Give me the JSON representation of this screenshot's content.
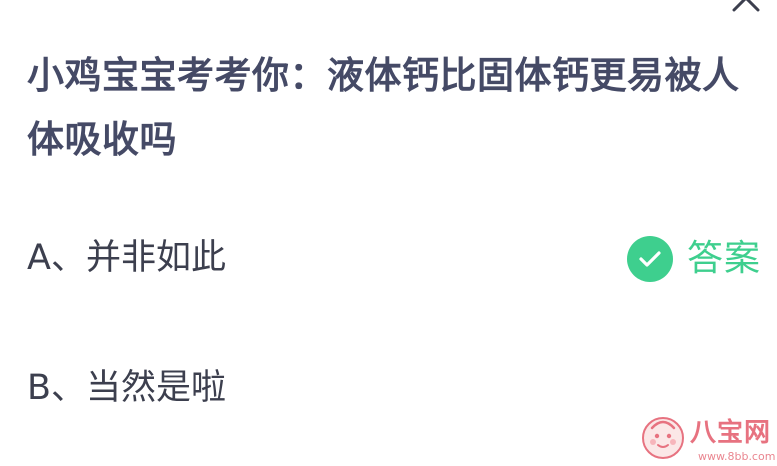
{
  "question": {
    "text": "小鸡宝宝考考你：液体钙比固体钙更易被人体吸收吗"
  },
  "options": [
    {
      "text": "A、并非如此",
      "is_answer": true
    },
    {
      "text": "B、当然是啦",
      "is_answer": false
    }
  ],
  "answer_badge": {
    "label": "答案",
    "icon": "check-icon",
    "color": "#3ecf8e"
  },
  "close_button": {
    "icon": "close-icon"
  },
  "watermark": {
    "brand": "八宝网",
    "url": "www.8bb.com",
    "icon": "baby-face-logo-icon",
    "color": "#e35a6a"
  }
}
